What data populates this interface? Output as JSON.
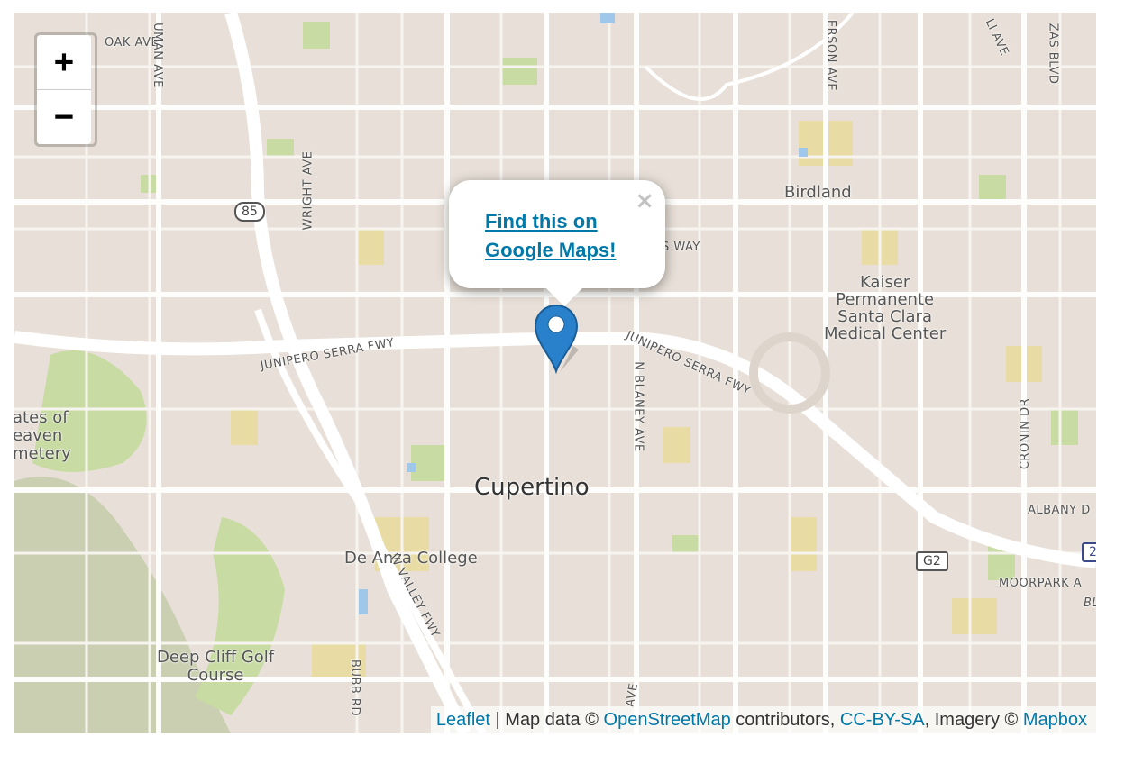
{
  "map": {
    "center_label": "Cupertino",
    "zoom_in_label": "+",
    "zoom_out_label": "−",
    "places": [
      {
        "id": "birdland",
        "text": "Birdland"
      },
      {
        "id": "kaiser",
        "text": "Kaiser\nPermanente\nSanta Clara\nMedical Center"
      },
      {
        "id": "gates",
        "text": "ates of\neaven\nmetery"
      },
      {
        "id": "de-anza",
        "text": "De Anza College"
      },
      {
        "id": "deep-cliff",
        "text": "Deep Cliff Golf\nCourse"
      }
    ],
    "streets": [
      {
        "id": "oak-ave",
        "text": "OAK AVE"
      },
      {
        "id": "uman-ave",
        "text": "UMAN AVE"
      },
      {
        "id": "erson-ave",
        "text": "ERSON AVE"
      },
      {
        "id": "li-ave",
        "text": "LI AVE"
      },
      {
        "id": "zas-blvd",
        "text": "ZAS BLVD"
      },
      {
        "id": "wright-ave",
        "text": "WRIGHT AVE"
      },
      {
        "id": "s-way",
        "text": "S WAY"
      },
      {
        "id": "junipero-west",
        "text": "JUNIPERO SERRA FWY"
      },
      {
        "id": "junipero-east",
        "text": "JUNIPERO SERRA FWY"
      },
      {
        "id": "n-blaney-ave",
        "text": "N BLANEY AVE"
      },
      {
        "id": "cronin-dr",
        "text": "CRONIN DR"
      },
      {
        "id": "albany",
        "text": "ALBANY D"
      },
      {
        "id": "moorpark",
        "text": "MOORPARK A"
      },
      {
        "id": "bl",
        "text": "BL"
      },
      {
        "id": "w-valley-fwy",
        "text": "W VALLEY FWY"
      },
      {
        "id": "bubb-rd",
        "text": "BUBB RD"
      },
      {
        "id": "ave-bottom",
        "text": "AVE"
      }
    ],
    "shields": [
      {
        "id": "hwy-85",
        "text": "85"
      },
      {
        "id": "g2",
        "text": "G2"
      },
      {
        "id": "i280",
        "text": "2"
      }
    ]
  },
  "popup": {
    "link_text": "Find this on Google Maps!",
    "close_label": "×"
  },
  "attribution": {
    "leaflet": "Leaflet",
    "sep": " | Map data © ",
    "osm": "OpenStreetMap",
    "contributors": " contributors, ",
    "license": "CC-BY-SA",
    "imagery": ", Imagery © ",
    "mapbox": "Mapbox"
  },
  "colors": {
    "link": "#0078a8",
    "marker": "#2a81cb",
    "land": "#e8e0d8"
  }
}
